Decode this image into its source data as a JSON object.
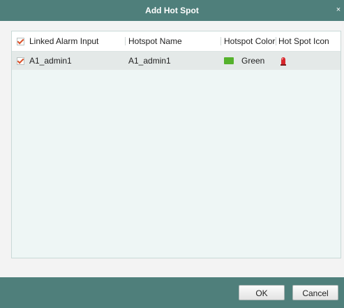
{
  "dialog": {
    "title": "Add Hot Spot",
    "close_glyph": "×"
  },
  "table": {
    "columns": [
      "Linked Alarm Input",
      "Hotspot Name",
      "Hotspot Color",
      "Hot Spot Icon"
    ],
    "header_checked": true,
    "rows": [
      {
        "checked": true,
        "alarm_input": "A1_admin1",
        "hotspot_name": "A1_admin1",
        "color_label": "Green",
        "color_hex": "#55b22d",
        "icon": "alarm-light-icon"
      }
    ]
  },
  "footer": {
    "ok_label": "OK",
    "cancel_label": "Cancel"
  },
  "colors": {
    "titlebar": "#4f7f7b",
    "table_bg": "#eef6f5",
    "checkmark": "#d9532c"
  }
}
